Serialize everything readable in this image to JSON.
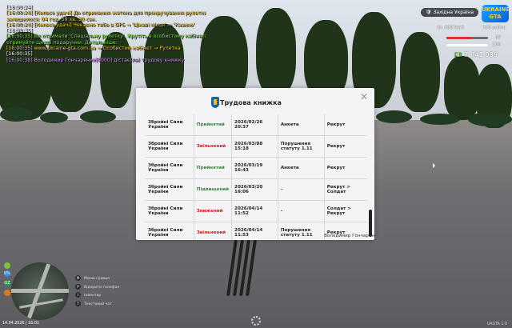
{
  "chat": [
    {
      "t": "[16:00:24]",
      "c": "white"
    },
    {
      "t": "[16:00:24] [Колесо удачі] До отримання жетона для прокручування рулетки",
      "c": "gold"
    },
    {
      "t": "залишилося: 04 год. 59 хв. 30 сек.",
      "c": "gold"
    },
    {
      "t": "[16:00:24] [Колесо удачі] Чекаємо тебе в GPS → 'Цікаві місця' → 'Казино'",
      "c": "gold"
    },
    {
      "t": "[16:00:35]",
      "c": "white"
    },
    {
      "t": "[16:00:35] Ви отримали 'Спеціальну рулетку'. Крутіть в особистому кабінеті та",
      "c": "green"
    },
    {
      "t": "отримуйте щедрі подарунки. Детальніше:",
      "c": "green"
    },
    {
      "t": "[16:00:35] www.ukraine-gta.com.ua → Особистий кабінет → Рулетка",
      "c": "gold"
    },
    {
      "t": "[16:00:35]",
      "c": "white"
    },
    {
      "t": "[16:00:38] Володимир Гончаренко[0000] дістає(ла) трудову книжку",
      "c": "purple"
    }
  ],
  "hud": {
    "server": "Західна Україна",
    "logo": "UKRAINE GTA",
    "id": "ID: 6897043",
    "online": "706 online",
    "health": "60",
    "armor": "100",
    "money": "7 041 089"
  },
  "modal": {
    "title": "Трудова книжка",
    "rows": [
      {
        "org": "Збройні Сили України",
        "status": "Прийнятий",
        "sc": "green",
        "date": "2026/02/26 20:37",
        "reason": "Анкета",
        "rank": "Рекрут"
      },
      {
        "org": "Збройні Сили України",
        "status": "Звільнений",
        "sc": "red",
        "date": "2026/03/08 15:18",
        "reason": "Порушення статуту 1.11",
        "rank": "Рекрут"
      },
      {
        "org": "Збройні Сили України",
        "status": "Прийнятий",
        "sc": "green",
        "date": "2026/03/19 16:43",
        "reason": "Анкета",
        "rank": "Рекрут"
      },
      {
        "org": "Збройні Сили України",
        "status": "Підвищений",
        "sc": "green",
        "date": "2026/03/20 16:06",
        "reason": "-",
        "rank": "Рекрут > Солдат"
      },
      {
        "org": "Збройні Сили України",
        "status": "Знижений",
        "sc": "red",
        "date": "2026/04/14 11:52",
        "reason": "-",
        "rank": "Солдат > Рекрут"
      },
      {
        "org": "Збройні Сили України",
        "status": "Звільнений",
        "sc": "red",
        "date": "2026/04/14 11:53",
        "reason": "Порушення статуту 1.11",
        "rank": "Рекрут"
      }
    ],
    "signature": "Володимир Гончарен"
  },
  "hints": [
    {
      "k": "M",
      "t": "Меню гравця"
    },
    {
      "k": "P",
      "t": "Відкрити телефон"
    },
    {
      "k": "I",
      "t": "Інвентар"
    },
    {
      "k": "T",
      "t": "Текстовий чат"
    }
  ],
  "status_icons": {
    "a": "0%",
    "b": "GZ"
  },
  "datetime": "14.04.2026 | 16:01",
  "version": "UAGTA 1.0"
}
